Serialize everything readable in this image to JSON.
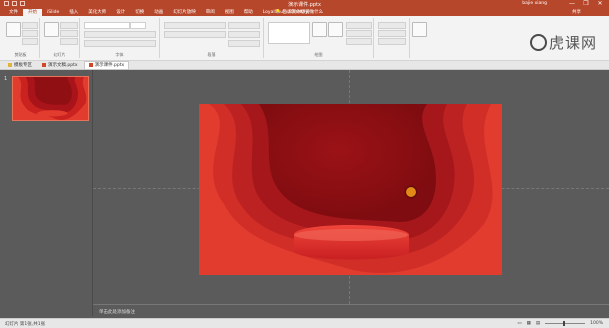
{
  "window": {
    "title": "演示课件.pptx",
    "user": "bajie xiang",
    "controls": [
      "—",
      "❐",
      "✕"
    ]
  },
  "ribbon_tabs": [
    "文件",
    "开始",
    "iSlide",
    "插入",
    "美化大师",
    "设计",
    "切换",
    "动画",
    "幻灯片放映",
    "审阅",
    "视图",
    "帮助",
    "LoyalSouler(OneKey)"
  ],
  "tell_me": "告诉我你想要做什么",
  "share": "共享",
  "ribbon_groups": [
    "剪贴板",
    "幻灯片",
    "字体",
    "段落",
    "绘图"
  ],
  "ribbon_buttons": {
    "paste": "粘贴",
    "new_slide": "新建\n幻灯片",
    "arrange": "排列",
    "quick_styles": "快速样式",
    "find": "查找",
    "replace": "替换",
    "select": "选择"
  },
  "file_tabs": [
    {
      "label": "模板专区",
      "active": false
    },
    {
      "label": "演示文稿.pptx",
      "active": false
    },
    {
      "label": "演示课件.pptx",
      "active": true
    }
  ],
  "slide_number": "1",
  "notes_placeholder": "单击此处添加备注",
  "status": {
    "left": "幻灯片 第1张,共1张",
    "zoom": "100%"
  },
  "watermark": {
    "text": "虎课网",
    "icon": "tiger-logo-icon"
  },
  "colors": {
    "accent": "#b7472a",
    "slide_red": "#e23c2f",
    "slide_dark": "#8f0f12"
  }
}
